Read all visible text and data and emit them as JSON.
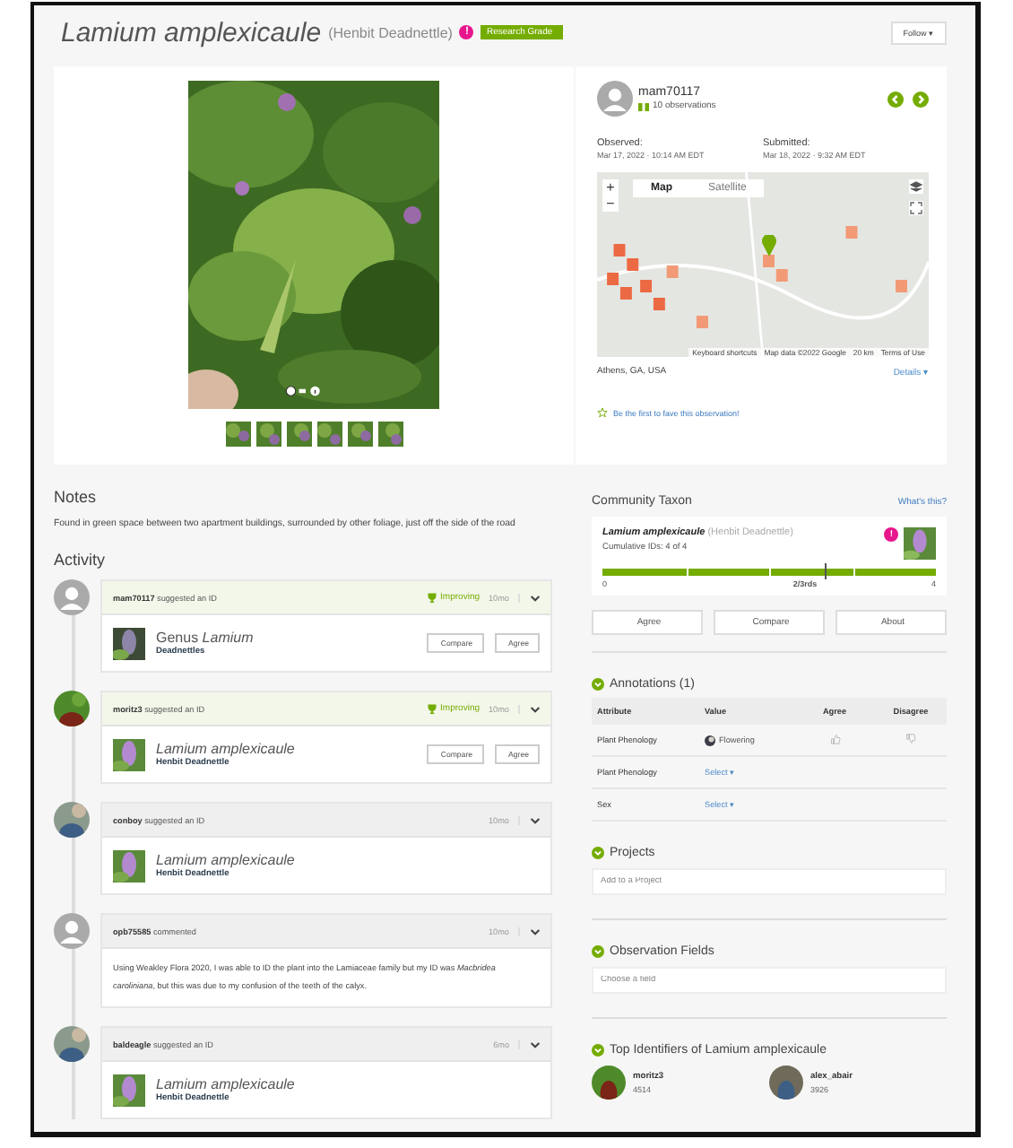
{
  "header": {
    "title": "Lamium amplexicaule",
    "common_name": "(Henbit Deadnettle)",
    "flag": "!",
    "quality_grade": "Research Grade",
    "follow_button": "Follow ▾"
  },
  "photo": {
    "kind": "picture",
    "thumbnails": [
      {
        "kind": "picture"
      },
      {
        "kind": "picture"
      },
      {
        "kind": "picture"
      },
      {
        "kind": "picture"
      },
      {
        "kind": "picture"
      },
      {
        "kind": "picture"
      }
    ]
  },
  "observer": {
    "name": "mam70117",
    "observations": "10 observations"
  },
  "observed": {
    "label": "Observed:",
    "value": "Mar 17, 2022 · 10:14 AM EDT"
  },
  "submitted": {
    "label": "Submitted:",
    "value": "Mar 18, 2022 · 9:32 AM EDT"
  },
  "map": {
    "tabs": [
      {
        "label": "Map",
        "selected": true
      },
      {
        "label": "Satellite",
        "selected": false
      }
    ],
    "zoom_in": "+",
    "zoom_out": "−",
    "attribution": [
      "Keyboard shortcuts",
      "Map data ©2022 Google",
      "20 km",
      "Terms of Use"
    ],
    "location": "Athens, GA, USA",
    "details": "Details ▾"
  },
  "fave": "Be the first to fave this observation!",
  "notes": {
    "title": "Notes",
    "text": "Found in green space between two apartment buildings, surrounded by other foliage, just off the side of the road"
  },
  "activity": {
    "title": "Activity",
    "items": [
      {
        "kind": "identification",
        "avatar": {
          "kind": "default"
        },
        "user": "mam70117",
        "action": "suggested an ID",
        "improving": "Improving",
        "time": "10mo",
        "taxon": "Genus *Lamium*",
        "common": "Deadnettles",
        "buttons": [
          "Compare",
          "Agree"
        ]
      },
      {
        "kind": "identification",
        "avatar": {
          "kind": "picture"
        },
        "user": "moritz3",
        "action": "suggested an ID",
        "improving": "Improving",
        "time": "10mo",
        "taxon": "Lamium amplexicaule",
        "common": "Henbit Deadnettle",
        "buttons": [
          "Compare",
          "Agree"
        ]
      },
      {
        "kind": "identification",
        "avatar": {
          "kind": "picture"
        },
        "user": "conboy",
        "action": "suggested an ID",
        "time": "10mo",
        "taxon": "Lamium amplexicaule",
        "common": "Henbit Deadnettle"
      },
      {
        "kind": "comment",
        "avatar": {
          "kind": "default"
        },
        "user": "opb75585",
        "action": "commented",
        "time": "10mo",
        "text": "Using Weakley Flora 2020, I was able to ID the plant into the Lamiaceae family but my ID was *Macbridea caroliniana*, but this was due to my confusion of the teeth of the calyx."
      },
      {
        "kind": "identification",
        "avatar": {
          "kind": "picture"
        },
        "user": "baldeagle",
        "action": "suggested an ID",
        "time": "6mo",
        "taxon": "Lamium amplexicaule",
        "common": "Henbit Deadnettle"
      }
    ]
  },
  "community_taxon": {
    "title": "Community Taxon",
    "help": "What's this?",
    "name": "Lamium amplexicaule",
    "common": "(Henbit Deadnettle)",
    "flag": "!",
    "cumulative": "Cumulative IDs: 4 of 4",
    "level": 1,
    "scale": [
      "0",
      "2/3rds",
      "4"
    ],
    "buttons": [
      "Agree",
      "Compare",
      "About"
    ]
  },
  "annotations": {
    "title": "Annotations (1)",
    "columns": [
      "Attribute",
      "Value",
      "Agree",
      "Disagree"
    ],
    "rows": [
      {
        "kind": "set",
        "attribute": "Plant Phenology",
        "value": "Flowering"
      },
      {
        "kind": "select",
        "attribute": "Plant Phenology",
        "value": "Select ▾"
      },
      {
        "kind": "select",
        "attribute": "Sex",
        "value": "Select ▾"
      }
    ]
  },
  "projects": {
    "title": "Projects",
    "placeholder": "Add to a Project"
  },
  "observation_fields": {
    "title": "Observation Fields",
    "placeholder": "Choose a field"
  },
  "top_identifiers": {
    "title": "Top Identifiers of Lamium amplexicaule",
    "items": [
      {
        "name": "moritz3",
        "count": "4514"
      },
      {
        "name": "alex_abair",
        "count": "3926"
      }
    ]
  }
}
